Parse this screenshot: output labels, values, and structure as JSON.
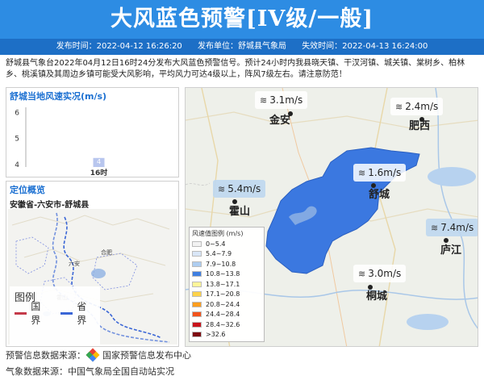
{
  "header": {
    "title": "大风蓝色预警[IV级/一般]",
    "publish_time": "发布时间：2022-04-12 16:26:20",
    "publisher": "发布单位：舒城县气象局",
    "expire_time": "失效时间：2022-04-13 16:24:00"
  },
  "description": "舒城县气象台2022年04月12日16时24分发布大风蓝色预警信号。预计24小时内我县晓天镇、干汊河镇、城关镇、棠树乡、柏林乡、桃溪镇及其周边乡镇可能受大风影响，平均风力可达4级以上，阵风7级左右。请注意防范！",
  "wind_panel": {
    "title": "舒城当地风速实况(m/s)"
  },
  "chart_data": {
    "type": "bar",
    "categories": [
      "16时"
    ],
    "values": [
      4
    ],
    "title": "舒城当地风速实况(m/s)",
    "yticks": [
      4,
      5,
      6
    ],
    "ylim": [
      3.9,
      6.2
    ],
    "data_labels": [
      "4"
    ],
    "color": "#b8c6ee"
  },
  "location": {
    "title": "定位概览",
    "path": "安徽省-六安市-舒城县",
    "mini_labels": [
      "合肥",
      "六安",
      "霍山"
    ],
    "legend_title": "图例",
    "legend_county": "国界",
    "legend_province": "省界",
    "county_color": "#c43a4a",
    "province_color": "#3a66d6"
  },
  "map": {
    "speed_legend_title": "风速值图例 (m/s)",
    "speed_legend": [
      {
        "label": "0~5.4",
        "color": "#f2f2f2"
      },
      {
        "label": "5.4~7.9",
        "color": "#d9e6f7"
      },
      {
        "label": "7.9~10.8",
        "color": "#aecdf0"
      },
      {
        "label": "10.8~13.8",
        "color": "#3f7fe0"
      },
      {
        "label": "13.8~17.1",
        "color": "#fff59a"
      },
      {
        "label": "17.1~20.8",
        "color": "#ffd34a"
      },
      {
        "label": "20.8~24.4",
        "color": "#ff9e1f"
      },
      {
        "label": "24.4~28.4",
        "color": "#f2541c"
      },
      {
        "label": "28.4~32.6",
        "color": "#c8141c"
      },
      {
        "label": ">32.6",
        "color": "#7d0a10"
      }
    ],
    "stations": [
      {
        "value": "3.1m/s",
        "city": "金安",
        "style": "white"
      },
      {
        "value": "2.4m/s",
        "city": "肥西",
        "style": "white"
      },
      {
        "value": "5.4m/s",
        "city": "霍山",
        "style": "blue"
      },
      {
        "value": "1.6m/s",
        "city": "舒城",
        "style": "white"
      },
      {
        "value": "7.4m/s",
        "city": "庐江",
        "style": "blue"
      },
      {
        "value": "3.0m/s",
        "city": "桐城",
        "style": "white"
      }
    ],
    "warning_color": "#3b78e0"
  },
  "footer": {
    "warning_source_label": "预警信息数据来源：",
    "warning_source": "国家预警信息发布中心",
    "weather_source": "气象数据来源：中国气象局全国自动站实况"
  }
}
